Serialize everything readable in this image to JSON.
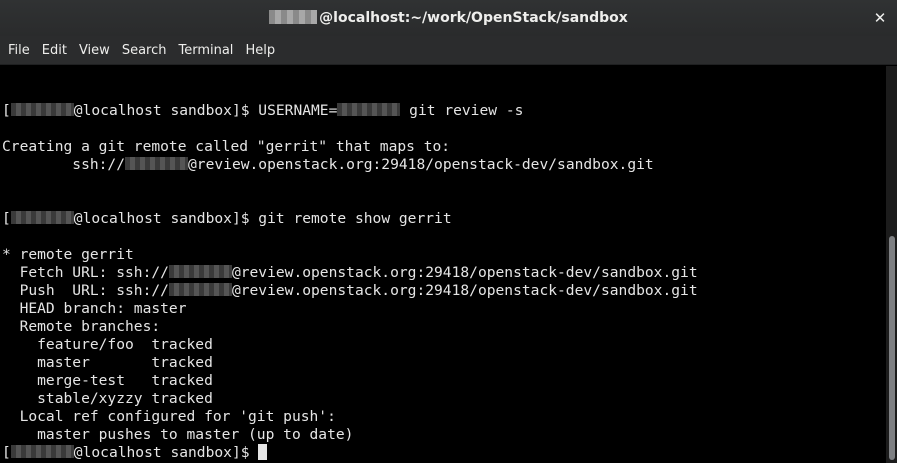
{
  "window": {
    "title_prefix_redacted": true,
    "title": "@localhost:~/work/OpenStack/sandbox",
    "close_glyph": "✕"
  },
  "menubar": {
    "items": [
      "File",
      "Edit",
      "View",
      "Search",
      "Terminal",
      "Help"
    ]
  },
  "terminal": {
    "lines": {
      "l1_pre": "[",
      "l1_post": "@localhost sandbox]$ USERNAME=",
      "l1_tail": " git review -s",
      "l2": "Creating a git remote called \"gerrit\" that maps to:",
      "l3_pre": "        ssh://",
      "l3_post": "@review.openstack.org:29418/openstack-dev/sandbox.git",
      "l4_pre": "[",
      "l4_post": "@localhost sandbox]$ git remote show gerrit",
      "l5": "* remote gerrit",
      "l6_pre": "  Fetch URL: ssh://",
      "l6_post": "@review.openstack.org:29418/openstack-dev/sandbox.git",
      "l7_pre": "  Push  URL: ssh://",
      "l7_post": "@review.openstack.org:29418/openstack-dev/sandbox.git",
      "l8": "  HEAD branch: master",
      "l9": "  Remote branches:",
      "l10": "    feature/foo  tracked",
      "l11": "    master       tracked",
      "l12": "    merge-test   tracked",
      "l13": "    stable/xyzzy tracked",
      "l14": "  Local ref configured for 'git push':",
      "l15": "    master pushes to master (up to date)",
      "l16_pre": "[",
      "l16_post": "@localhost sandbox]$ "
    }
  },
  "colors": {
    "terminal_bg": "#000000",
    "terminal_fg": "#e5e5e5",
    "chrome_bg": "#2b2c2d",
    "chrome_fg": "#eeeeec"
  }
}
